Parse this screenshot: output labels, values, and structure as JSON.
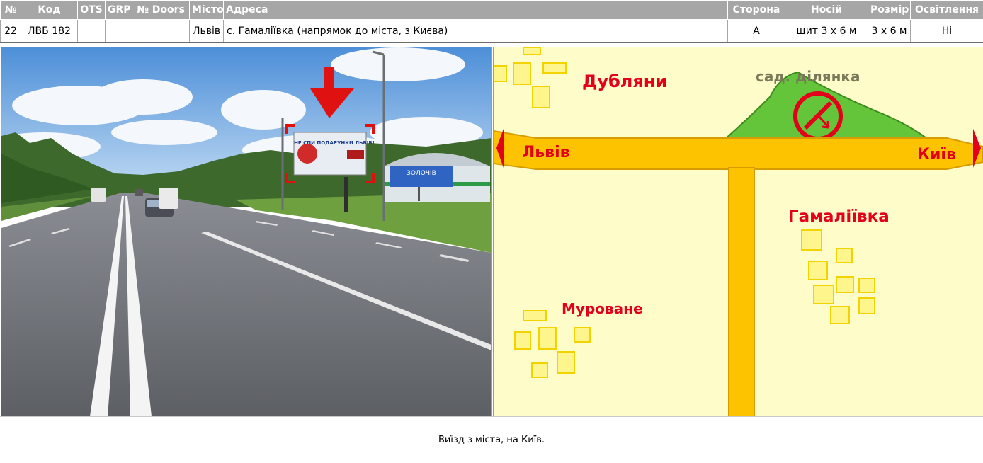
{
  "table": {
    "headers": {
      "num": "№",
      "code": "Код",
      "ots": "OTS",
      "grp": "GRP",
      "doors": "№ Doors",
      "city": "Місто",
      "address": "Адреса",
      "side": "Сторона",
      "carrier": "Носій",
      "size": "Розмір",
      "lighting": "Освітлення"
    },
    "row": {
      "num": "22",
      "code": "ЛВБ 182",
      "ots": "",
      "grp": "",
      "doors": "",
      "city": "Львів",
      "address": "с. Гамаліївка (напрямок до міста, з Києва)",
      "side": "А",
      "carrier": "щит 3 х 6 м",
      "size": "3 х 6 м",
      "lighting": "Ні"
    }
  },
  "photo": {
    "billboard_text": "НЕ СПИ ПОДАРУНКИ ЛЬВІВ!",
    "road_sign_text": "ЗОЛОЧІВ"
  },
  "map": {
    "labels": {
      "dublyany": "Дубляни",
      "garden_plot": "сад. ділянка",
      "lviv": "Львів",
      "kyiv": "Київ",
      "hamaliivka": "Гамаліївка",
      "murovane": "Муроване"
    },
    "colors": {
      "background": "#fefcc8",
      "road": "#fdc300",
      "label_red": "#e3001b",
      "garden_green": "#64c43a",
      "house_fill": "#fef68d"
    }
  },
  "caption": "Виїзд з міста, на Київ."
}
